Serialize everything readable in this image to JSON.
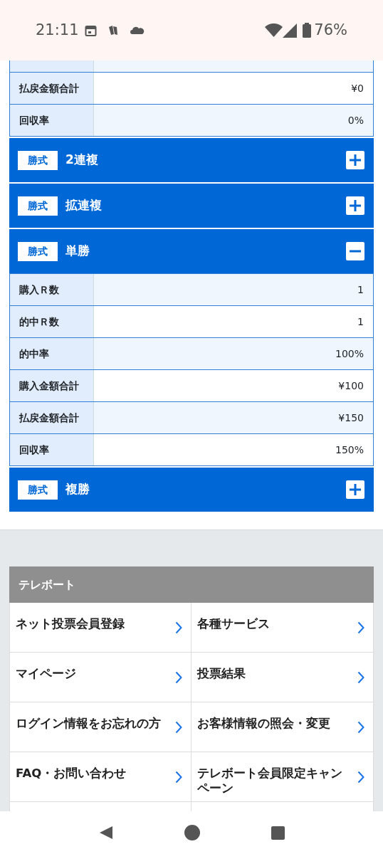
{
  "status_bar": {
    "time": "21:11",
    "battery": "76%"
  },
  "top_rows": [
    {
      "label": "払戻金額合計",
      "value": "¥0"
    },
    {
      "label": "回収率",
      "value": "0%"
    }
  ],
  "bet_types": [
    {
      "tag": "勝式",
      "name": "2連複",
      "expanded": false
    },
    {
      "tag": "勝式",
      "name": "拡連複",
      "expanded": false
    },
    {
      "tag": "勝式",
      "name": "単勝",
      "expanded": true,
      "rows": [
        {
          "label": "購入Ｒ数",
          "value": "1"
        },
        {
          "label": "的中Ｒ数",
          "value": "1"
        },
        {
          "label": "的中率",
          "value": "100%"
        },
        {
          "label": "購入金額合計",
          "value": "¥100"
        },
        {
          "label": "払戻金額合計",
          "value": "¥150"
        },
        {
          "label": "回収率",
          "value": "150%"
        }
      ]
    },
    {
      "tag": "勝式",
      "name": "複勝",
      "expanded": false
    }
  ],
  "footer_menu": {
    "title": "テレボート",
    "links": [
      "ネット投票会員登録",
      "各種サービス",
      "マイページ",
      "投票結果",
      "ログイン情報をお忘れの方",
      "お客様情報の照会・変更",
      "FAQ・お問い合わせ",
      "テレボート会員限定キャンペーン"
    ]
  }
}
